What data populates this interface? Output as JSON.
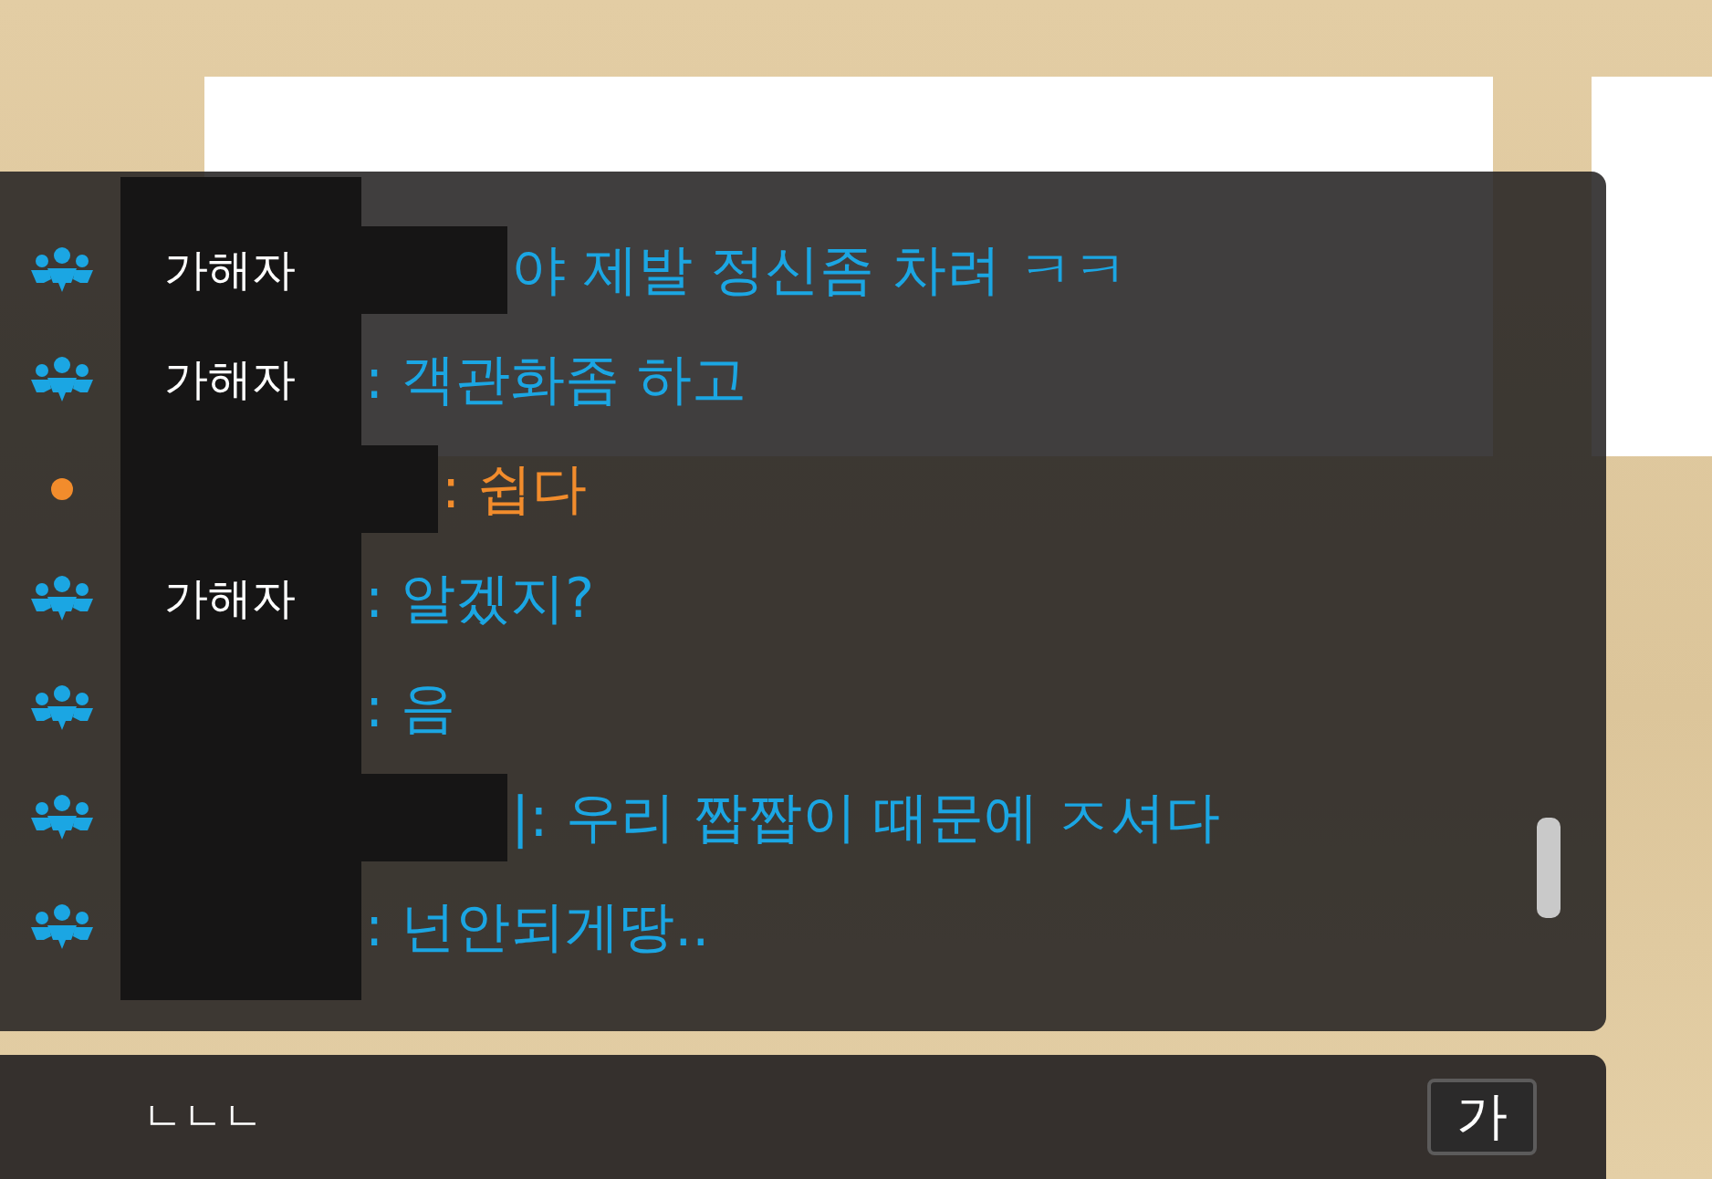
{
  "chat": {
    "messages": [
      {
        "kind": "party",
        "name_covered": true,
        "tag": "가해자",
        "text": "야 제발 정신좀 차려 ㅋㅋ"
      },
      {
        "kind": "party",
        "name_covered": false,
        "tag": "가해자",
        "text": ": 객관화좀 하고"
      },
      {
        "kind": "general",
        "name_covered": true,
        "text": ": 쉽다"
      },
      {
        "kind": "party",
        "name_covered": false,
        "tag": "가해자",
        "text": ": 알겠지?"
      },
      {
        "kind": "party",
        "name_covered": false,
        "text": ": 음"
      },
      {
        "kind": "party",
        "name_covered": true,
        "text": "|: 우리 짭짭이 때문에 ㅈ셔다"
      },
      {
        "kind": "party",
        "name_covered": false,
        "text": ": 넌안되게땅.."
      }
    ]
  },
  "input": {
    "value": "ㄴㄴㄴ",
    "ime_mode": "가"
  }
}
